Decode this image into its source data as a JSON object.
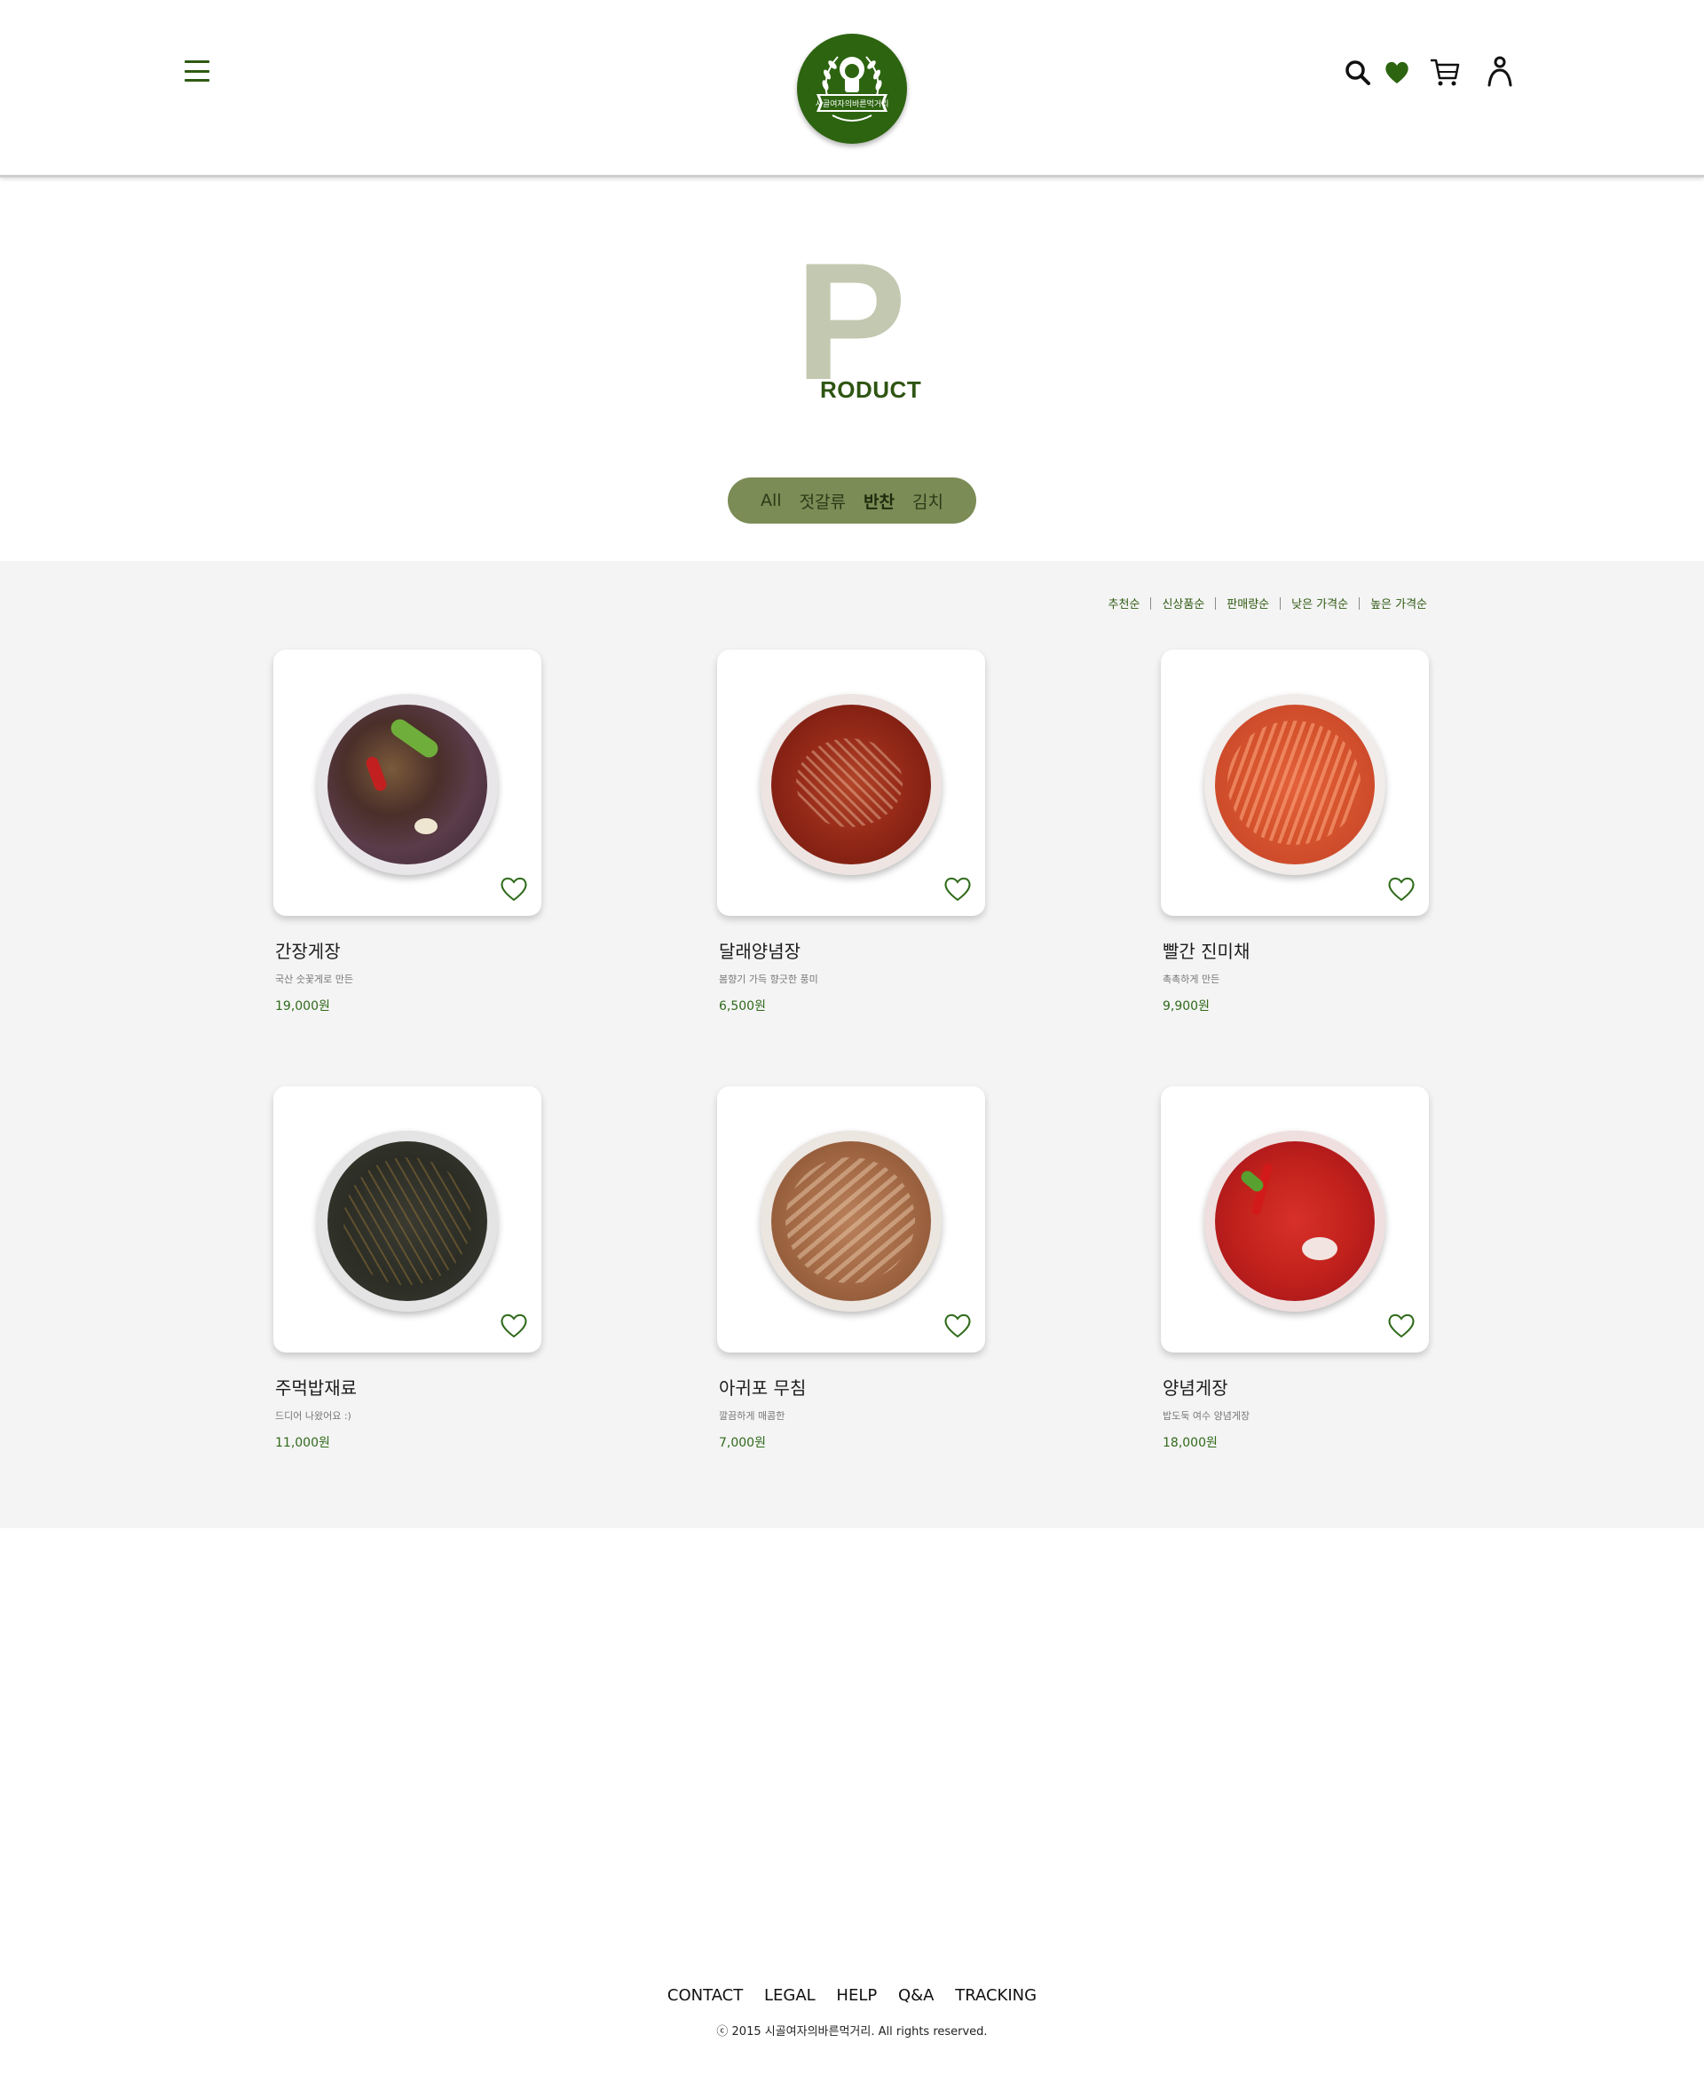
{
  "header": {
    "logo_text": "시골여자의바른먹거리",
    "icons": [
      "search-icon",
      "heart-icon",
      "cart-icon",
      "user-icon"
    ]
  },
  "page_title": {
    "big_letter": "P",
    "rest": "RODUCT"
  },
  "filter": {
    "tabs": [
      {
        "label": "All",
        "active": false
      },
      {
        "label": "젓갈류",
        "active": false
      },
      {
        "label": "반찬",
        "active": true
      },
      {
        "label": "김치",
        "active": false
      }
    ]
  },
  "sort": {
    "options": [
      "추천순",
      "신상품순",
      "판매량순",
      "낮은 가격순",
      "높은 가격순"
    ]
  },
  "products": [
    {
      "name": "간장게장",
      "desc": "국산 숫꽃게로 만든",
      "price": "19,000원",
      "image": "soy-sauce-crab"
    },
    {
      "name": "달래양념장",
      "desc": "봄향기 가득 향긋한 풍미",
      "price": "6,500원",
      "image": "wild-chive-sauce"
    },
    {
      "name": "빨간 진미채",
      "desc": "촉촉하게 만든",
      "price": "9,900원",
      "image": "spicy-squid-strips"
    },
    {
      "name": "주먹밥재료",
      "desc": "드디어 나왔어요 :)",
      "price": "11,000원",
      "image": "rice-ball-seasoning"
    },
    {
      "name": "아귀포 무침",
      "desc": "깔끔하게 매콤한",
      "price": "7,000원",
      "image": "seasoned-monkfish"
    },
    {
      "name": "양념게장",
      "desc": "밥도둑 여수 양념게장",
      "price": "18,000원",
      "image": "spicy-marinated-crab"
    }
  ],
  "colors": {
    "brand_green": "#2d6410",
    "filter_bg": "#7b8c56",
    "title_p": "#c3c8b0",
    "price_green": "#2f6a1a"
  },
  "footer": {
    "links": [
      "CONTACT",
      "LEGAL",
      "HELP",
      "Q&A",
      "TRACKING"
    ],
    "copyright": "ⓒ 2015 시골여자의바른먹거리. All rights reserved."
  }
}
